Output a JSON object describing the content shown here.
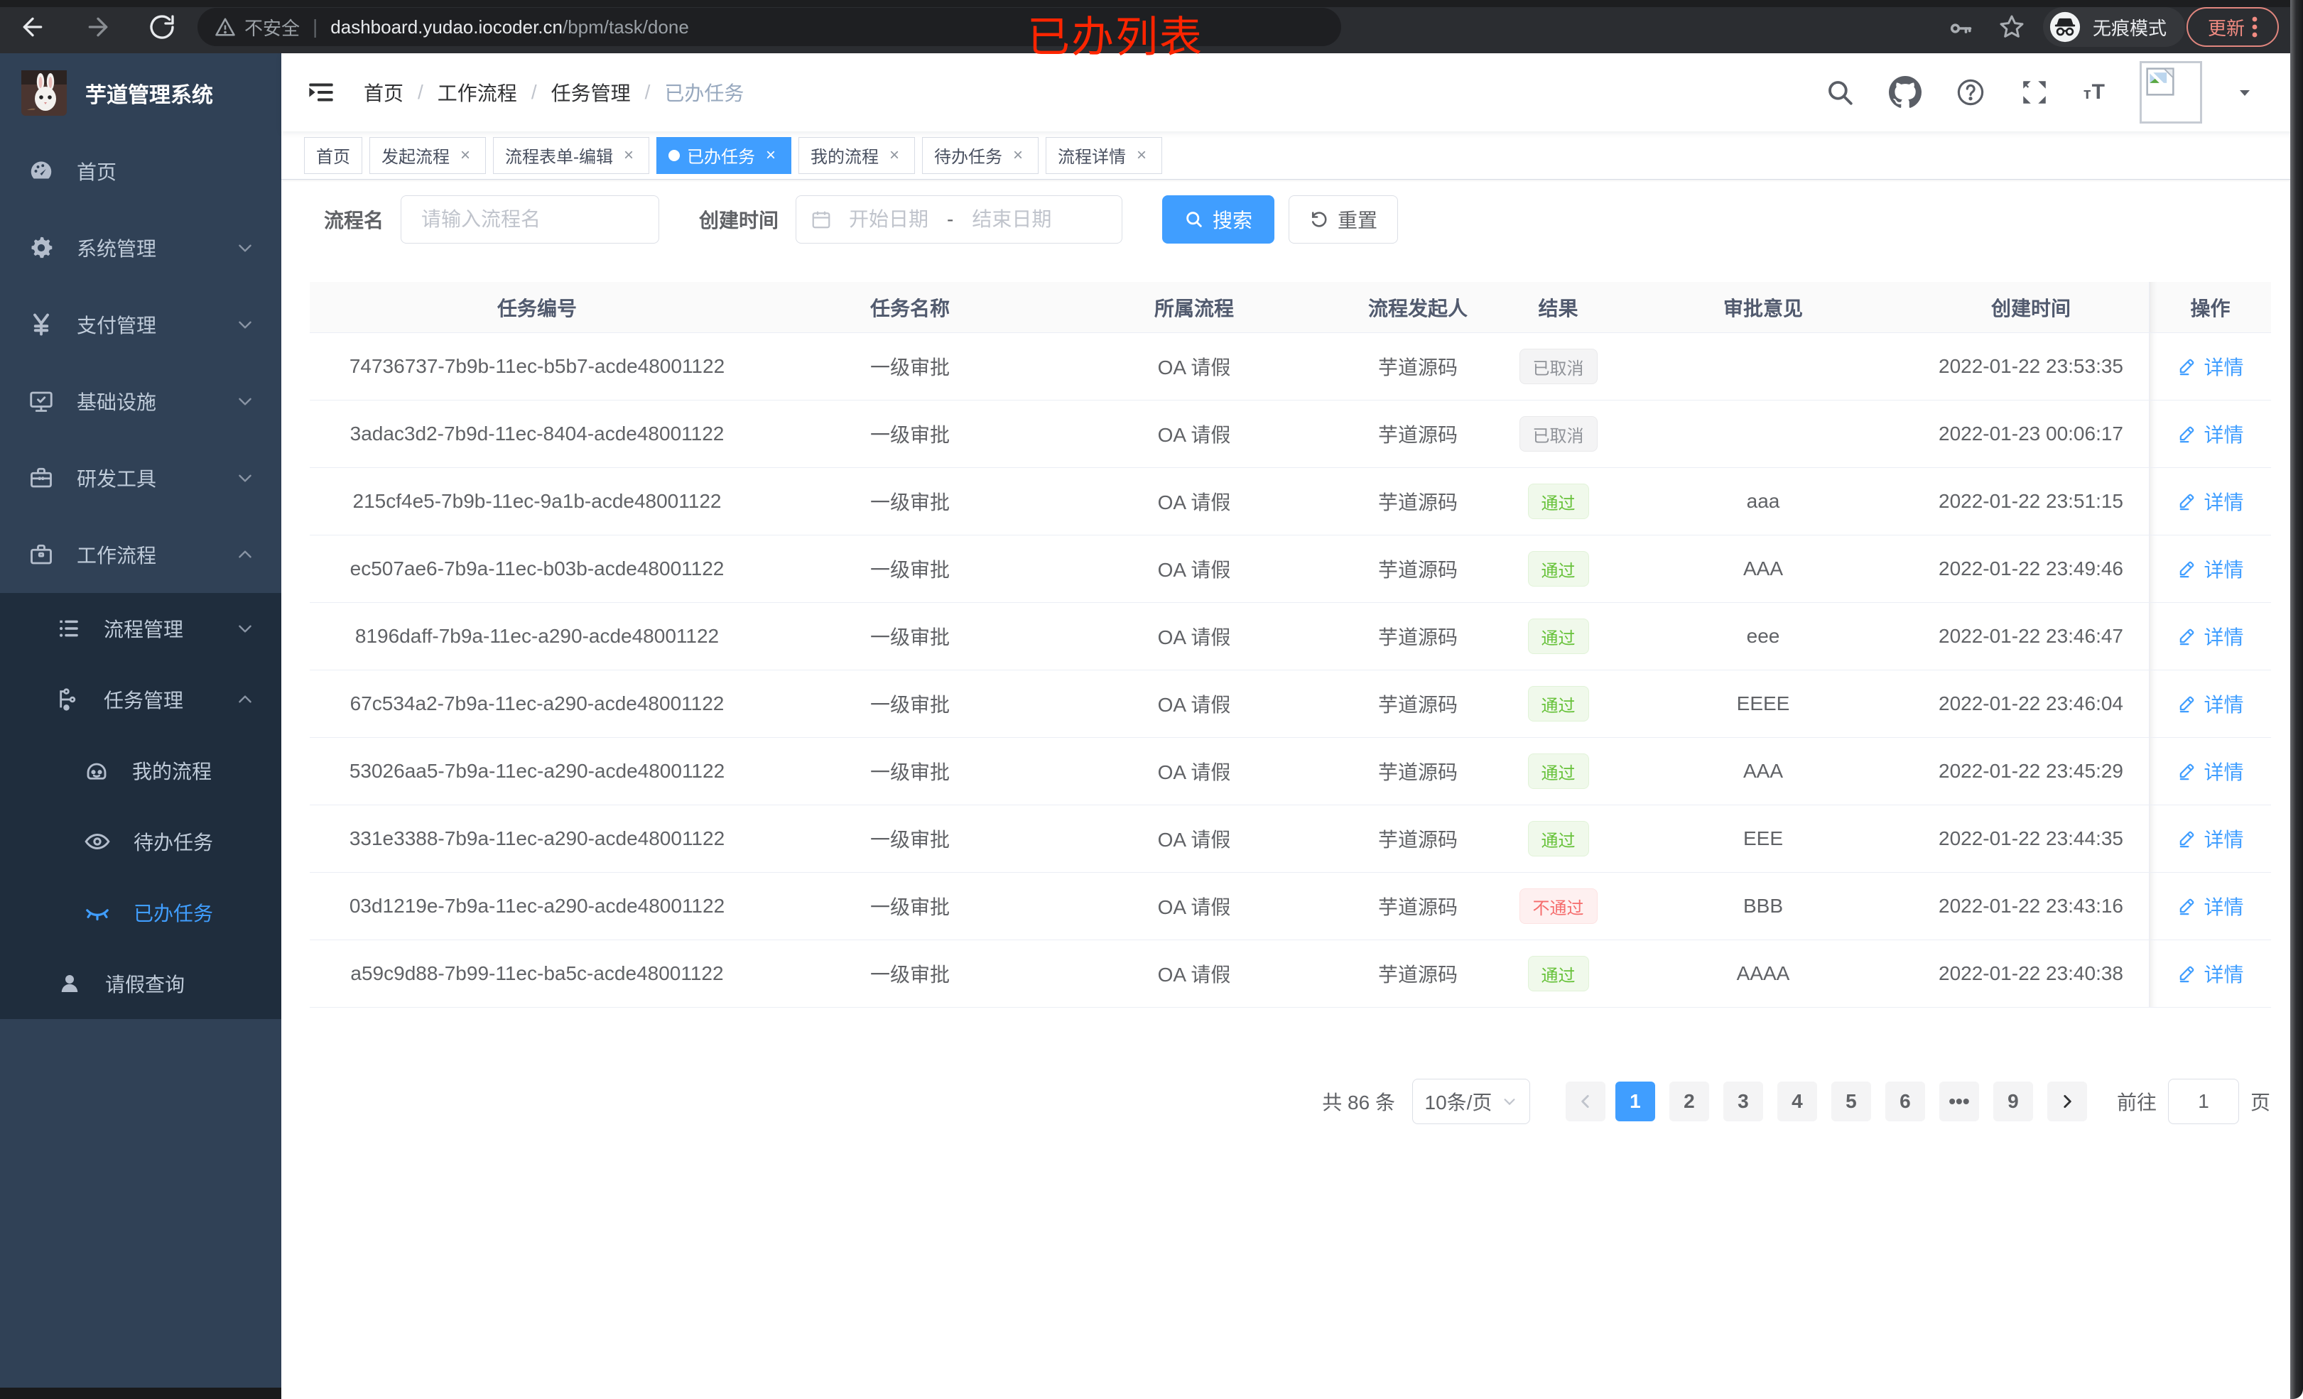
{
  "browser": {
    "security_label": "不安全",
    "url_host": "dashboard.yudao.iocoder.cn",
    "url_path": "/bpm/task/done",
    "incognito_label": "无痕模式",
    "update_label": "更新"
  },
  "annotation": "已办列表",
  "sidebar": {
    "logo_title": "芋道管理系统",
    "items": [
      {
        "id": "home",
        "label": "首页",
        "icon": "dashboard-icon",
        "level": 1,
        "chevron": ""
      },
      {
        "id": "system",
        "label": "系统管理",
        "icon": "gear-icon",
        "level": 1,
        "chevron": "down"
      },
      {
        "id": "payment",
        "label": "支付管理",
        "icon": "yen-icon",
        "level": 1,
        "chevron": "down"
      },
      {
        "id": "infrastructure",
        "label": "基础设施",
        "icon": "monitor-icon",
        "level": 1,
        "chevron": "down"
      },
      {
        "id": "devtools",
        "label": "研发工具",
        "icon": "toolbox-icon",
        "level": 1,
        "chevron": "down"
      },
      {
        "id": "workflow",
        "label": "工作流程",
        "icon": "briefcase-icon",
        "level": 1,
        "chevron": "up"
      },
      {
        "id": "process-mgmt",
        "label": "流程管理",
        "icon": "tree-icon",
        "level": 2,
        "chevron": "down"
      },
      {
        "id": "task-mgmt",
        "label": "任务管理",
        "icon": "share-icon",
        "level": 2,
        "chevron": "up"
      },
      {
        "id": "my-process",
        "label": "我的流程",
        "icon": "face-icon",
        "level": 3,
        "chevron": ""
      },
      {
        "id": "todo-tasks",
        "label": "待办任务",
        "icon": "eye-icon",
        "level": 3,
        "chevron": ""
      },
      {
        "id": "done-tasks",
        "label": "已办任务",
        "icon": "closed-eye-icon",
        "level": 3,
        "chevron": "",
        "active": true
      },
      {
        "id": "leave-query",
        "label": "请假查询",
        "icon": "user-icon",
        "level": 2,
        "chevron": ""
      }
    ]
  },
  "breadcrumb": [
    "首页",
    "工作流程",
    "任务管理",
    "已办任务"
  ],
  "tabs": [
    {
      "label": "首页",
      "closable": false,
      "active": false
    },
    {
      "label": "发起流程",
      "closable": true,
      "active": false
    },
    {
      "label": "流程表单-编辑",
      "closable": true,
      "active": false
    },
    {
      "label": "已办任务",
      "closable": true,
      "active": true
    },
    {
      "label": "我的流程",
      "closable": true,
      "active": false
    },
    {
      "label": "待办任务",
      "closable": true,
      "active": false
    },
    {
      "label": "流程详情",
      "closable": true,
      "active": false
    }
  ],
  "filters": {
    "name_label": "流程名",
    "name_placeholder": "请输入流程名",
    "date_label": "创建时间",
    "date_start_placeholder": "开始日期",
    "date_separator": "-",
    "date_end_placeholder": "结束日期",
    "search_label": "搜索",
    "reset_label": "重置"
  },
  "table": {
    "columns": [
      "任务编号",
      "任务名称",
      "所属流程",
      "流程发起人",
      "结果",
      "审批意见",
      "创建时间",
      "操作"
    ],
    "detail_label": "详情",
    "rows": [
      {
        "id": "74736737-7b9b-11ec-b5b7-acde48001122",
        "name": "一级审批",
        "process": "OA 请假",
        "starter": "芋道源码",
        "result": "已取消",
        "result_type": "info",
        "comment": "",
        "created": "2022-01-22 23:53:35"
      },
      {
        "id": "3adac3d2-7b9d-11ec-8404-acde48001122",
        "name": "一级审批",
        "process": "OA 请假",
        "starter": "芋道源码",
        "result": "已取消",
        "result_type": "info",
        "comment": "",
        "created": "2022-01-23 00:06:17"
      },
      {
        "id": "215cf4e5-7b9b-11ec-9a1b-acde48001122",
        "name": "一级审批",
        "process": "OA 请假",
        "starter": "芋道源码",
        "result": "通过",
        "result_type": "success",
        "comment": "aaa",
        "created": "2022-01-22 23:51:15"
      },
      {
        "id": "ec507ae6-7b9a-11ec-b03b-acde48001122",
        "name": "一级审批",
        "process": "OA 请假",
        "starter": "芋道源码",
        "result": "通过",
        "result_type": "success",
        "comment": "AAA",
        "created": "2022-01-22 23:49:46"
      },
      {
        "id": "8196daff-7b9a-11ec-a290-acde48001122",
        "name": "一级审批",
        "process": "OA 请假",
        "starter": "芋道源码",
        "result": "通过",
        "result_type": "success",
        "comment": "eee",
        "created": "2022-01-22 23:46:47"
      },
      {
        "id": "67c534a2-7b9a-11ec-a290-acde48001122",
        "name": "一级审批",
        "process": "OA 请假",
        "starter": "芋道源码",
        "result": "通过",
        "result_type": "success",
        "comment": "EEEE",
        "created": "2022-01-22 23:46:04"
      },
      {
        "id": "53026aa5-7b9a-11ec-a290-acde48001122",
        "name": "一级审批",
        "process": "OA 请假",
        "starter": "芋道源码",
        "result": "通过",
        "result_type": "success",
        "comment": "AAA",
        "created": "2022-01-22 23:45:29"
      },
      {
        "id": "331e3388-7b9a-11ec-a290-acde48001122",
        "name": "一级审批",
        "process": "OA 请假",
        "starter": "芋道源码",
        "result": "通过",
        "result_type": "success",
        "comment": "EEE",
        "created": "2022-01-22 23:44:35"
      },
      {
        "id": "03d1219e-7b9a-11ec-a290-acde48001122",
        "name": "一级审批",
        "process": "OA 请假",
        "starter": "芋道源码",
        "result": "不通过",
        "result_type": "danger",
        "comment": "BBB",
        "created": "2022-01-22 23:43:16"
      },
      {
        "id": "a59c9d88-7b99-11ec-ba5c-acde48001122",
        "name": "一级审批",
        "process": "OA 请假",
        "starter": "芋道源码",
        "result": "通过",
        "result_type": "success",
        "comment": "AAAA",
        "created": "2022-01-22 23:40:38"
      }
    ]
  },
  "pagination": {
    "total_label": "共 86 条",
    "page_size": "10条/页",
    "pages": [
      "1",
      "2",
      "3",
      "4",
      "5",
      "6",
      "•••",
      "9"
    ],
    "active_page": "1",
    "goto_label": "前往",
    "goto_value": "1",
    "page_unit": "页"
  },
  "colors": {
    "accent": "#409eff",
    "success": "#67c23a",
    "danger": "#f56c6c",
    "info": "#909399",
    "sidebar_bg": "#304156",
    "submenu_bg": "#1f2d3d",
    "annotation_red": "#fe2500"
  }
}
